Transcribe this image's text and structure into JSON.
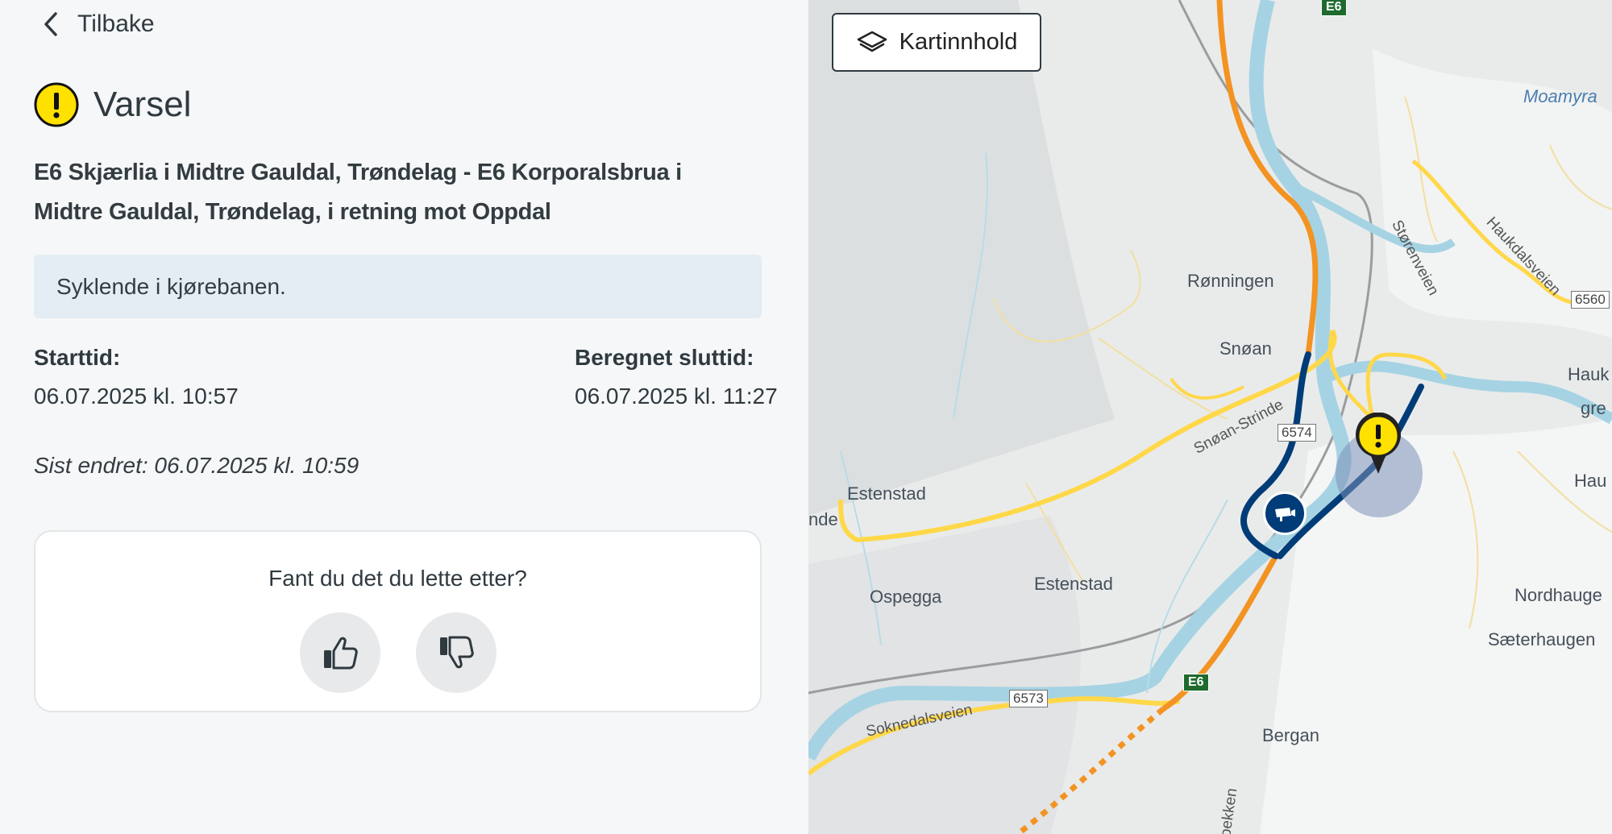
{
  "nav": {
    "back_label": "Tilbake"
  },
  "alert": {
    "title": "Varsel",
    "location": "E6 Skjærlia i Midtre Gauldal, Trøndelag - E6 Korporalsbrua i Midtre Gauldal, Trøndelag, i retning mot Oppdal",
    "description": "Syklende i kjørebanen.",
    "start_label": "Starttid:",
    "start_value": "06.07.2025 kl. 10:57",
    "end_label": "Beregnet sluttid:",
    "end_value": "06.07.2025 kl. 11:27",
    "last_changed": "Sist endret:  06.07.2025 kl. 10:59"
  },
  "feedback": {
    "question": "Fant du det du lette etter?"
  },
  "map": {
    "layers_button": "Kartinnhold",
    "places": [
      "Moamyra",
      "Rønningen",
      "Snøan",
      "Estenstad",
      "Estenstad",
      "Ospegga",
      "Bergan",
      "Hauk",
      "gre",
      "Hau",
      "Nordhauge",
      "Sæterhaugen",
      "nde"
    ],
    "road_labels": [
      "Støren­veien",
      "Haukdalsveien",
      "Snøan-Strinde",
      "Soknedalsveien",
      "bekken"
    ],
    "road_numbers": [
      "6560",
      "6574",
      "6573"
    ],
    "e_roads": [
      "E6",
      "E6"
    ]
  },
  "colors": {
    "warning": "#ffe100",
    "route": "#003c78",
    "e6_orange": "#f39322",
    "secondary_yellow": "#ffd84a",
    "water": "#a6d3e3"
  }
}
